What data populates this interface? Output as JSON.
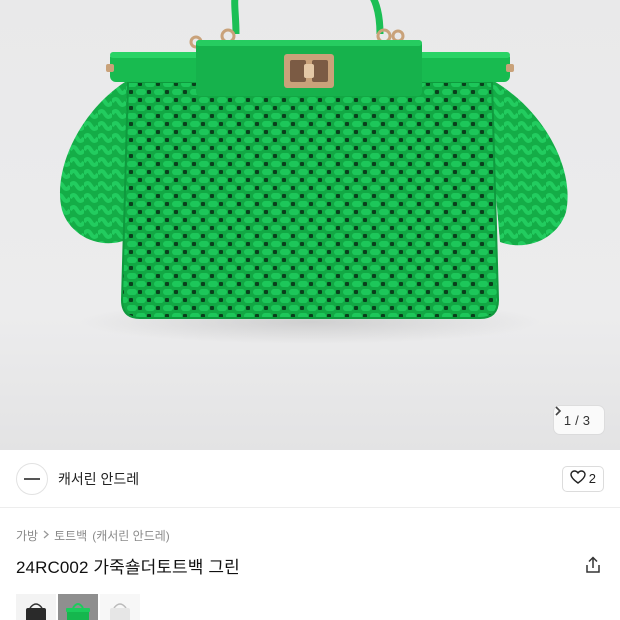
{
  "product_image": {
    "alt_icon": "green-woven-handbag-image",
    "bag_color": "#15b74e",
    "hardware_color": "#c9a27a"
  },
  "pager": {
    "current": "1",
    "separator": "/",
    "total": "3",
    "next_icon": "chevron-right-icon"
  },
  "brand": {
    "logo_icon": "brand-logo-icon",
    "name": "캐서린 안드레"
  },
  "like": {
    "icon": "heart-icon",
    "count": "2"
  },
  "breadcrumb": {
    "items": [
      "가방",
      "토트백",
      "(캐서린 안드레)"
    ],
    "separator_icon": "chevron-right-icon"
  },
  "product": {
    "title": "24RC002 가죽숄더토트백 그린",
    "share_icon": "share-icon"
  },
  "thumbnails": {
    "selected_index": 1
  }
}
